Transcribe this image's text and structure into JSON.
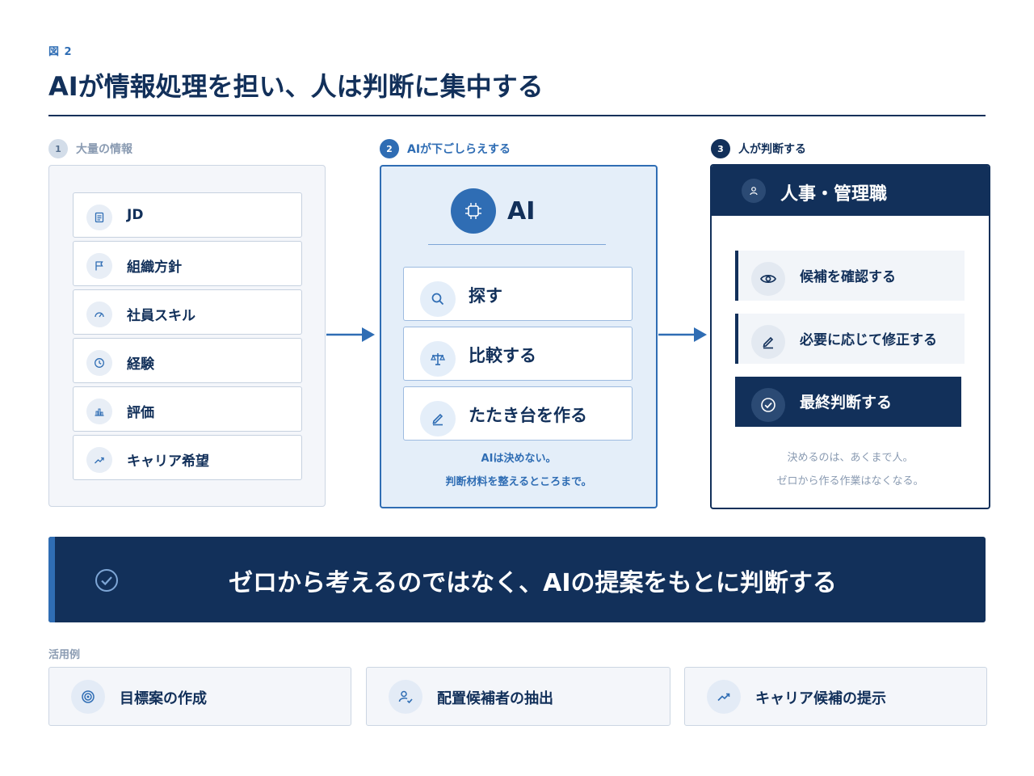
{
  "figure_label": "図 2",
  "title": "AIが情報処理を担い、人は判断に集中する",
  "steps": [
    {
      "num": "1",
      "label": "大量の情報"
    },
    {
      "num": "2",
      "label": "AIが下ごしらえする"
    },
    {
      "num": "3",
      "label": "人が判断する"
    }
  ],
  "info_items": [
    {
      "label": "JD",
      "icon": "document-icon"
    },
    {
      "label": "組織方針",
      "icon": "flag-icon"
    },
    {
      "label": "社員スキル",
      "icon": "gauge-icon"
    },
    {
      "label": "経験",
      "icon": "clock-icon"
    },
    {
      "label": "評価",
      "icon": "bar-chart-icon"
    },
    {
      "label": "キャリア希望",
      "icon": "trend-up-icon"
    }
  ],
  "ai_panel": {
    "title": "AI",
    "tasks": [
      {
        "label": "探す",
        "icon": "search-icon"
      },
      {
        "label": "比較する",
        "icon": "scale-icon"
      },
      {
        "label": "たたき台を作る",
        "icon": "pencil-icon"
      }
    ],
    "note_line1": "AIは決めない。",
    "note_line2": "判断材料を整えるところまで。"
  },
  "human_panel": {
    "title": "人事・管理職",
    "actions": [
      {
        "label": "候補を確認する",
        "icon": "eye-icon"
      },
      {
        "label": "必要に応じて修正する",
        "icon": "pencil-icon"
      },
      {
        "label": "最終判断する",
        "icon": "check-circle-icon"
      }
    ],
    "note_line1": "決めるのは、あくまで人。",
    "note_line2": "ゼロから作る作業はなくなる。"
  },
  "banner": {
    "text": "ゼロから考えるのではなく、AIの提案をもとに判断する"
  },
  "use_cases": {
    "label": "活用例",
    "items": [
      {
        "label": "目標案の作成",
        "icon": "target-icon"
      },
      {
        "label": "配置候補者の抽出",
        "icon": "user-check-icon"
      },
      {
        "label": "キャリア候補の提示",
        "icon": "trend-up-icon"
      }
    ]
  },
  "colors": {
    "navy": "#12305a",
    "blue": "#2f6db4",
    "light_blue": "#e4eef9",
    "gray_text": "#8a9bb2"
  }
}
